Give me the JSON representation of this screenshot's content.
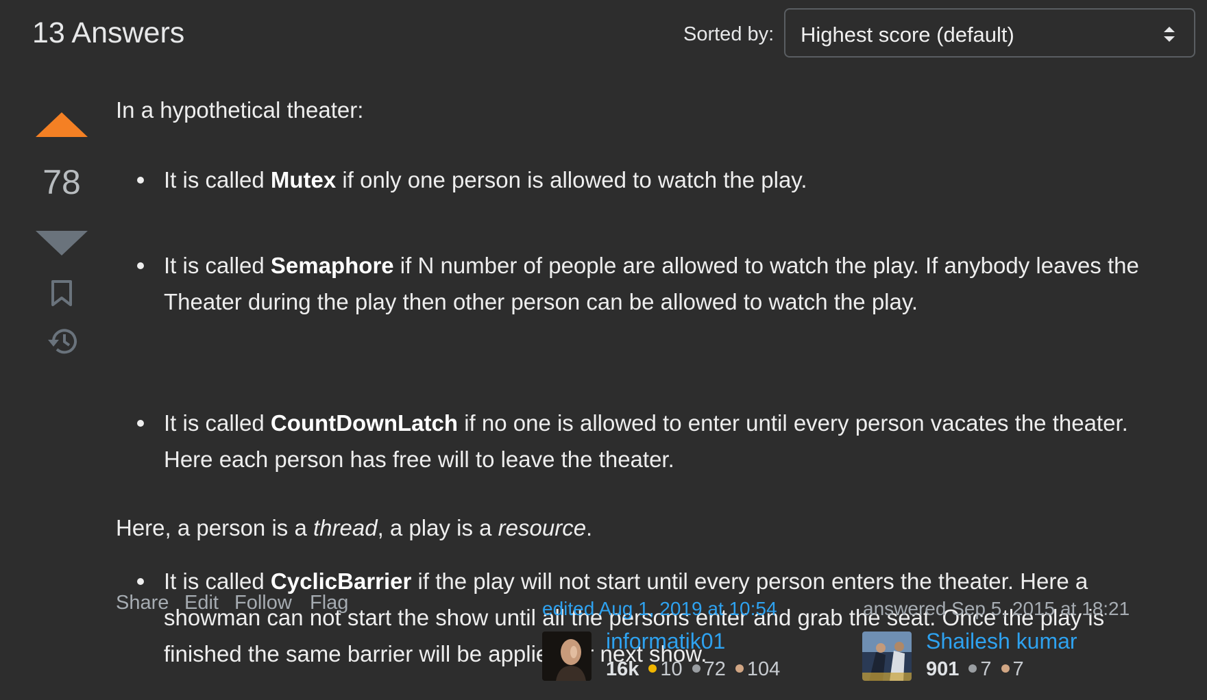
{
  "header": {
    "answers_count": "13 Answers",
    "sort_label": "Sorted by:",
    "sort_value": "Highest score (default)"
  },
  "vote": {
    "score": "78",
    "upvote_color": "#f48024",
    "downvote_color": "#6a737c"
  },
  "post": {
    "intro": "In a hypothetical theater:",
    "bullets": [
      {
        "prefix": "It is called ",
        "term": "Mutex",
        "rest": " if only one person is allowed to watch the play."
      },
      {
        "prefix": "It is called ",
        "term": "Semaphore",
        "rest": " if N number of people are allowed to watch the play. If anybody leaves the Theater during the play then other person can be allowed to watch the play."
      },
      {
        "prefix": "It is called ",
        "term": "CountDownLatch",
        "rest": " if no one is allowed to enter until every person vacates the theater. Here each person has free will to leave the theater."
      },
      {
        "prefix": "It is called ",
        "term": "CyclicBarrier",
        "rest": " if the play will not start until every person enters the theater. Here a showman can not start the show until all the persons enter and grab the seat. Once the play is finished the same barrier will be applied for next show."
      }
    ],
    "outro_a": "Here, a person is a ",
    "outro_thread": "thread",
    "outro_b": ", a play is a ",
    "outro_resource": "resource",
    "outro_c": "."
  },
  "actions": {
    "share": "Share",
    "edit": "Edit",
    "follow": "Follow",
    "flag": "Flag"
  },
  "editor": {
    "time": "edited Aug 1, 2019 at 10:54",
    "name": "informatik01",
    "rep": "16k",
    "gold": "10",
    "silver": "72",
    "bronze": "104"
  },
  "author": {
    "time": "answered Sep 5, 2015 at 18:21",
    "name": "Shailesh kumar",
    "rep": "901",
    "silver": "7",
    "bronze": "7"
  },
  "badge_colors": {
    "gold": "#f1b600",
    "silver": "#9a9ea2",
    "bronze": "#d1a684"
  }
}
